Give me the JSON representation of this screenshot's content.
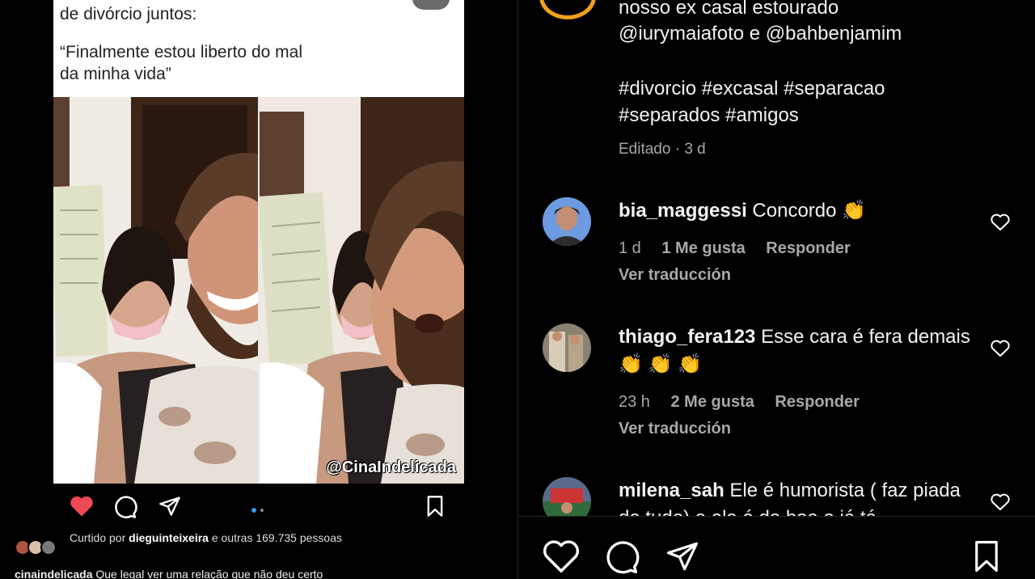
{
  "post": {
    "meme_lines": [
      "de divórcio juntos:",
      "“Finalmente estou liberto do mal",
      "da minha vida”"
    ],
    "watermark": "@CinaIndelicada",
    "liked_by_prefix": "Curtido por",
    "liked_by_user": "dieguinteixeira",
    "liked_by_suffix": "e outras 169.735 pessoas",
    "caption_user": "cinaindelicada",
    "caption_text": "Que legal ver uma relação que não deu certo",
    "liked": true
  },
  "panel": {
    "caption_lines": [
      "nosso ex casal estourado",
      "@iurymaiafoto e @bahbenjamim",
      "#divorcio #excasal #separacao",
      "#separados #amigos"
    ],
    "edited": "Editado · 3 d"
  },
  "comments": [
    {
      "user": "bia_maggessi",
      "text": "Concordo 👏",
      "time": "1 d",
      "likes": "1 Me gusta",
      "reply": "Responder",
      "translate": "Ver traducción"
    },
    {
      "user": "thiago_fera123",
      "text": "Esse cara é fera demais 👏 👏 👏",
      "time": "23 h",
      "likes": "2 Me gusta",
      "reply": "Responder",
      "translate": "Ver traducción"
    },
    {
      "user": "milena_sah",
      "text": "Ele é humorista ( faz piada de tudo) e ela é de boa e já tá",
      "time": "",
      "likes": "",
      "reply": "",
      "translate": ""
    }
  ],
  "colors": {
    "accent_like": "#ed4956",
    "muted": "#a8a8a8",
    "background": "#000000"
  },
  "icons": [
    "heart-icon",
    "comment-icon",
    "share-icon",
    "bookmark-icon",
    "carousel-dots-icon"
  ]
}
